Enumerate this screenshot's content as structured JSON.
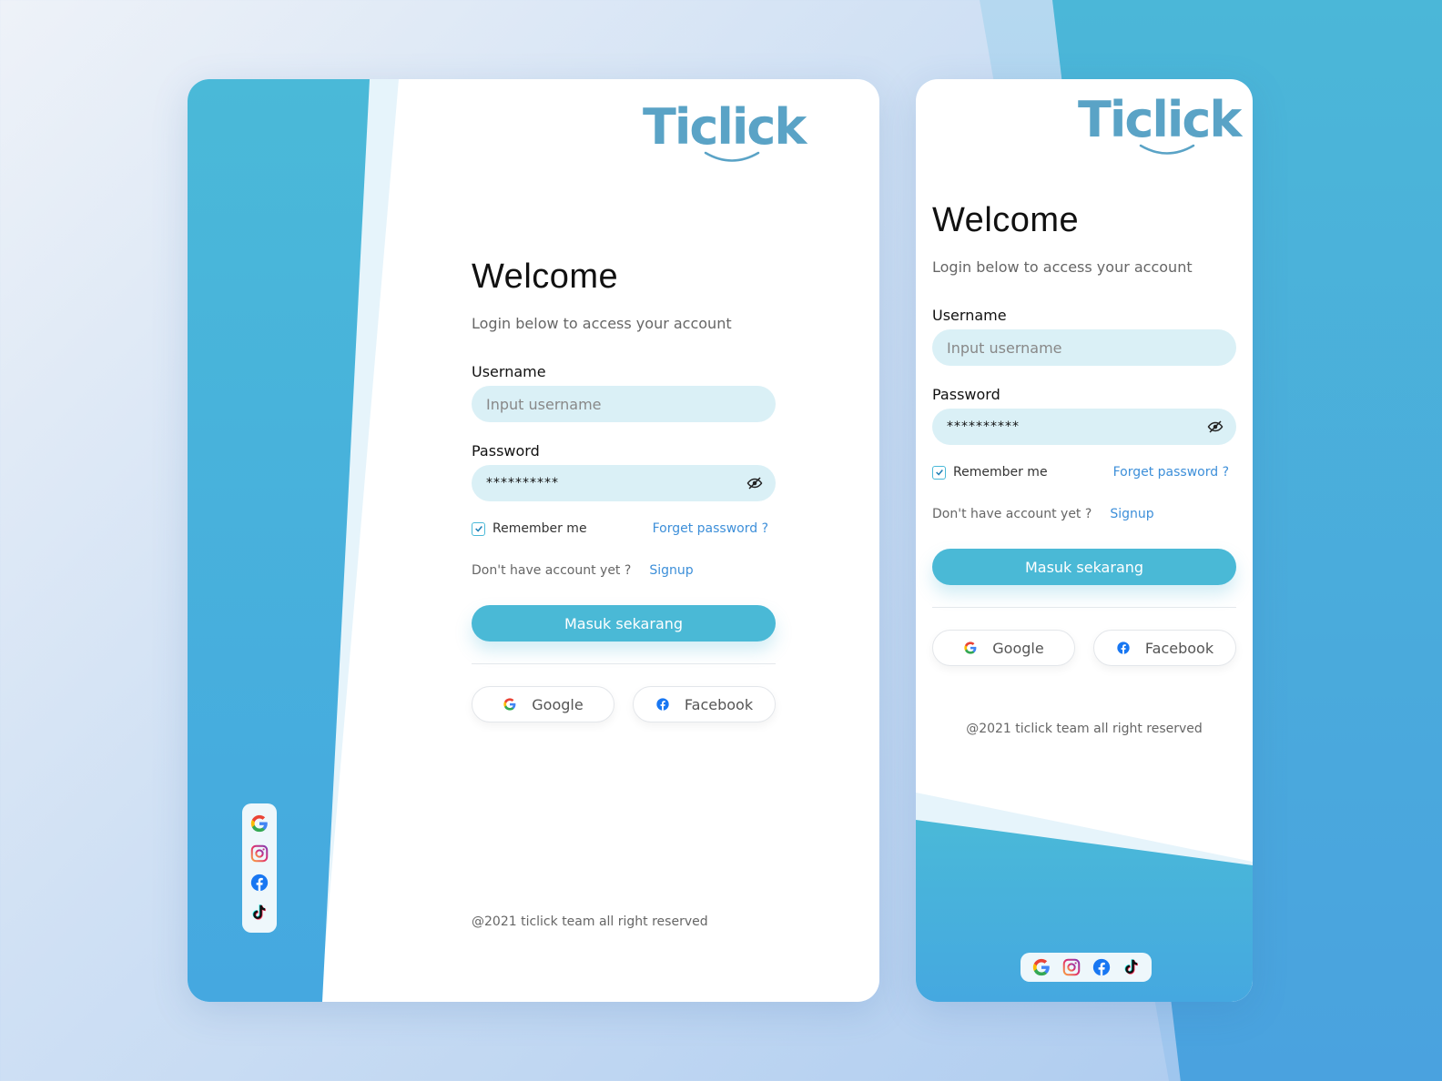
{
  "brand": {
    "name": "Ticlick",
    "color": "#5aa3c6"
  },
  "colors": {
    "primary": "#4ab9d6",
    "link": "#3d8fd9",
    "input_bg": "#daf0f6"
  },
  "login": {
    "title": "Welcome",
    "subtitle": "Login below to access your account",
    "username_label": "Username",
    "username_placeholder": "Input username",
    "password_label": "Password",
    "password_value": "**********",
    "remember_label": "Remember me",
    "remember_checked": true,
    "forgot_label": "Forget password ?",
    "no_account_text": "Don't have account yet ?",
    "signup_label": "Signup",
    "submit_label": "Masuk sekarang",
    "google_label": "Google",
    "facebook_label": "Facebook",
    "footer": "@2021 ticlick team all right reserved"
  },
  "social_icons": [
    "google-icon",
    "instagram-icon",
    "facebook-icon",
    "tiktok-icon"
  ]
}
